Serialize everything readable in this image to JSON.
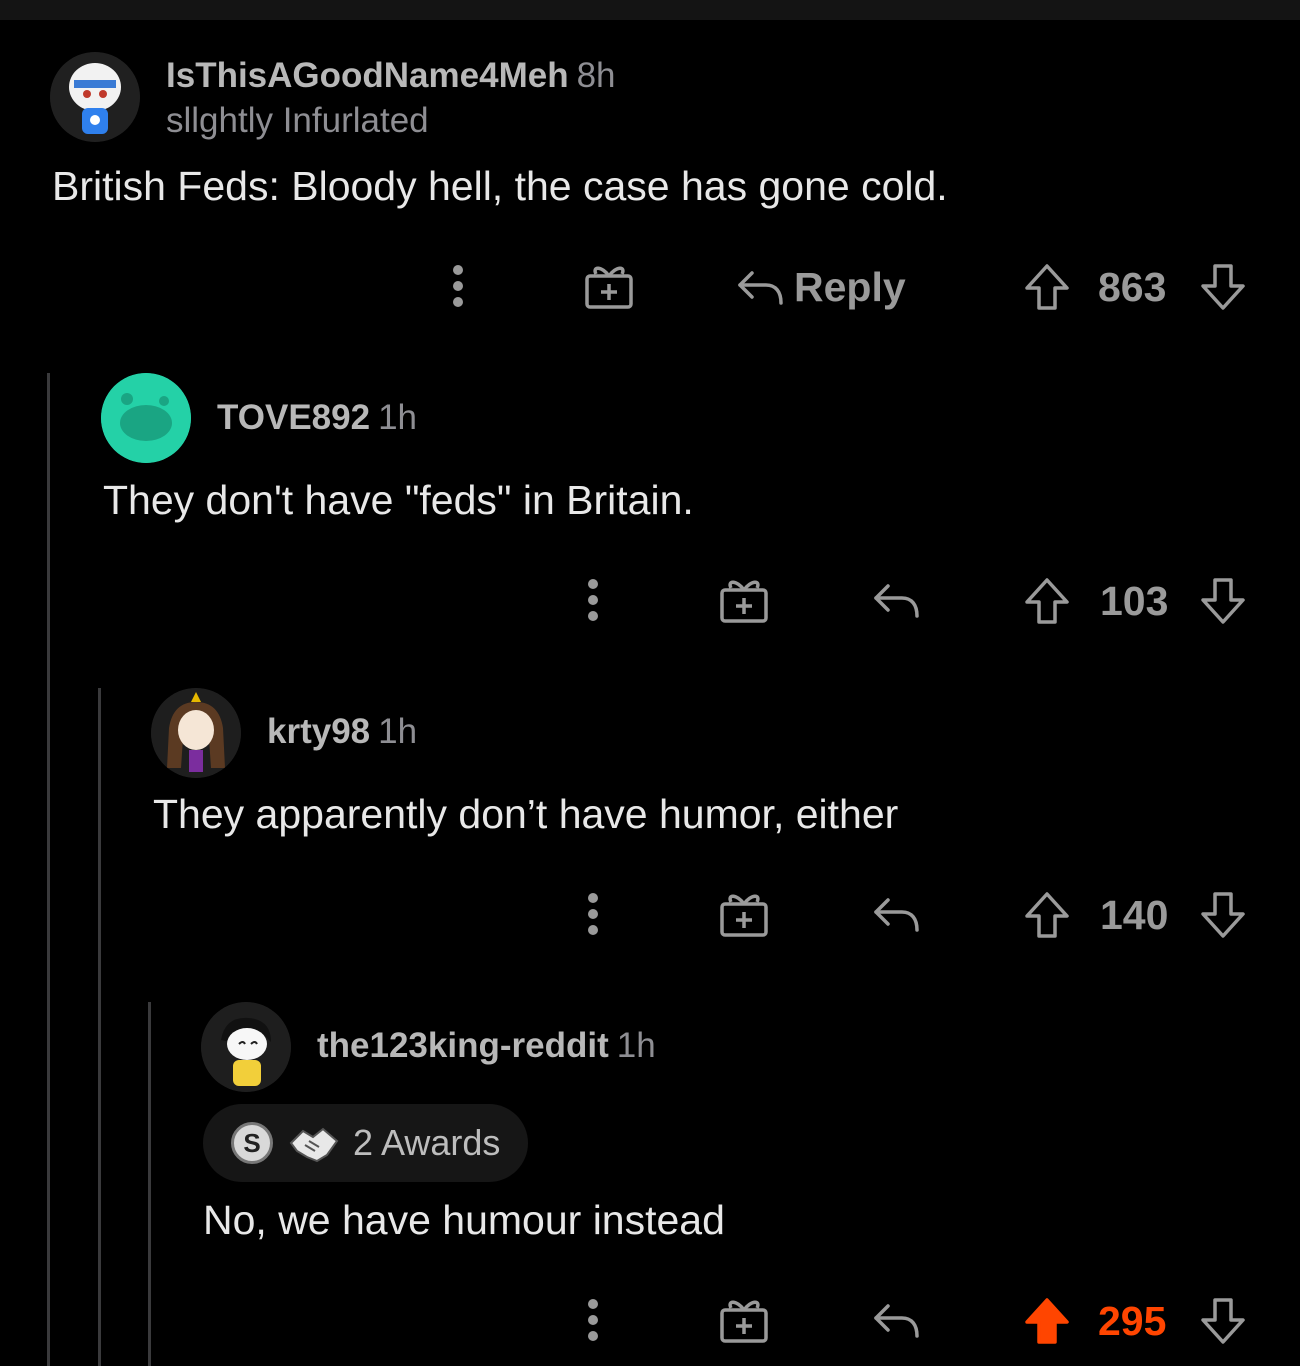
{
  "comments": [
    {
      "username": "IsThisAGoodName4Meh",
      "time": "8h",
      "flair": "sllghtly Infurlated",
      "body": "British Feds: Bloody hell, the case has gone cold.",
      "reply_label": "Reply",
      "score": "863",
      "upvoted": false
    },
    {
      "username": "TOVE892",
      "time": "1h",
      "body": "They don't have \"feds\" in Britain.",
      "score": "103",
      "upvoted": false
    },
    {
      "username": "krty98",
      "time": "1h",
      "body": "They apparently don’t have humor, either",
      "score": "140",
      "upvoted": false
    },
    {
      "username": "the123king-reddit",
      "time": "1h",
      "awards": "2 Awards",
      "body": "No, we have humour instead",
      "score": "295",
      "upvoted": true
    }
  ],
  "colors": {
    "background": "#000000",
    "upvote_active": "#ff4500",
    "muted": "#9a9a9a",
    "thread_line": "#3a3a3c"
  },
  "icons": [
    "more-icon",
    "gift-icon",
    "reply-icon",
    "upvote-icon",
    "downvote-icon",
    "silver-award-icon",
    "handshake-award-icon"
  ]
}
